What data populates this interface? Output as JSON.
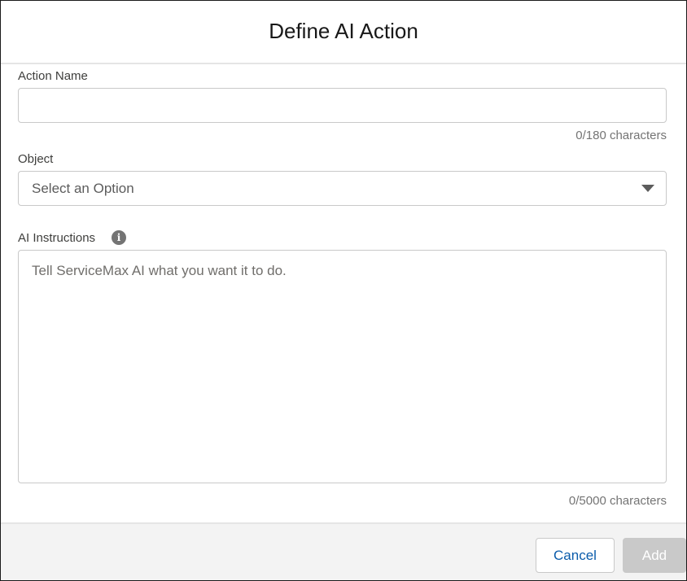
{
  "modal": {
    "title": "Define AI Action"
  },
  "form": {
    "action_name": {
      "label": "Action Name",
      "value": "",
      "counter": "0/180 characters"
    },
    "object": {
      "label": "Object",
      "selected": "Select an Option"
    },
    "instructions": {
      "label": "AI Instructions",
      "info_icon": "info-icon",
      "placeholder": "Tell ServiceMax AI what you want it to do.",
      "value": "",
      "counter": "0/5000 characters"
    }
  },
  "footer": {
    "cancel_label": "Cancel",
    "add_label": "Add"
  },
  "colors": {
    "cancel_text": "#0b5cab",
    "add_disabled_bg": "#c9c9c9",
    "footer_bg": "#f3f3f3"
  }
}
